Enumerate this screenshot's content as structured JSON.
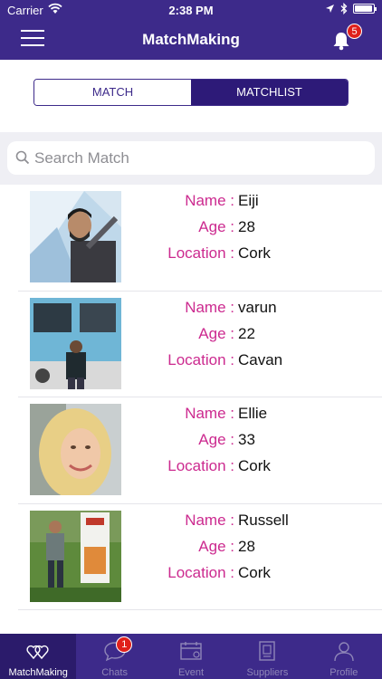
{
  "status_bar": {
    "carrier": "Carrier",
    "time": "2:38 PM"
  },
  "nav": {
    "title": "MatchMaking",
    "notification_count": "5"
  },
  "segments": {
    "match": "MATCH",
    "matchlist": "MATCHLIST",
    "selected": "MATCHLIST"
  },
  "search": {
    "placeholder": "Search Match"
  },
  "labels": {
    "name": "Name :",
    "age": "Age :",
    "location": "Location :"
  },
  "matches": [
    {
      "name": "Eiji",
      "age": "28",
      "location": "Cork"
    },
    {
      "name": "varun",
      "age": "22",
      "location": "Cavan"
    },
    {
      "name": "Ellie",
      "age": "33",
      "location": "Cork"
    },
    {
      "name": "Russell",
      "age": "28",
      "location": "Cork"
    }
  ],
  "tabs": [
    {
      "label": "MatchMaking",
      "icon": "hearts-icon",
      "active": true
    },
    {
      "label": "Chats",
      "icon": "chat-bubble-icon",
      "badge": "1"
    },
    {
      "label": "Event",
      "icon": "calendar-icon"
    },
    {
      "label": "Suppliers",
      "icon": "supplier-book-icon"
    },
    {
      "label": "Profile",
      "icon": "person-icon"
    }
  ],
  "colors": {
    "primary": "#3d2a8a",
    "accent": "#cc2a8f",
    "badge": "#e0201b"
  }
}
